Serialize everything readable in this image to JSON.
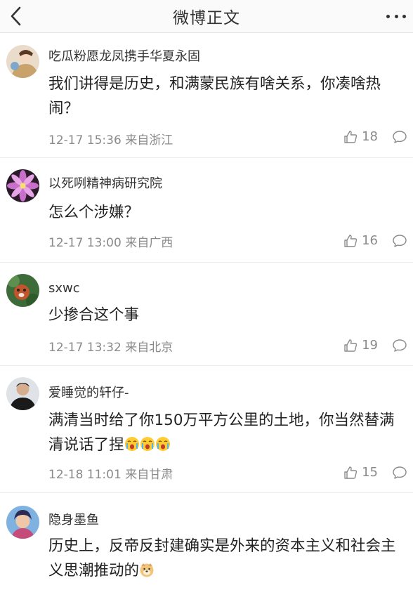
{
  "header": {
    "title": "微博正文"
  },
  "comments": [
    {
      "username": "吃瓜粉愿龙凤携手华夏永固",
      "text": "我们讲得是历史，和满蒙民族有啥关系，你凑啥热闹？",
      "meta": "12-17 15:36 来自浙江",
      "likes": "18"
    },
    {
      "username": "以死咧精神病研究院",
      "text": "怎么个涉嫌？",
      "meta": "12-17 13:00 来自广西",
      "likes": "16"
    },
    {
      "username": "sxwc",
      "text": "少掺合这个事",
      "meta": "12-17 13:32 来自北京",
      "likes": "19"
    },
    {
      "username": "爱睡觉的轩仔-",
      "text": "满清当时给了你150万平方公里的土地，你当然替满清说话了捏",
      "meta": "12-18 11:01 来自甘肃",
      "likes": "15"
    },
    {
      "username": "隐身墨鱼",
      "text": "历史上，反帝反封建确实是外来的资本主义和社会主义思潮推动的",
      "meta": "",
      "likes": ""
    }
  ]
}
